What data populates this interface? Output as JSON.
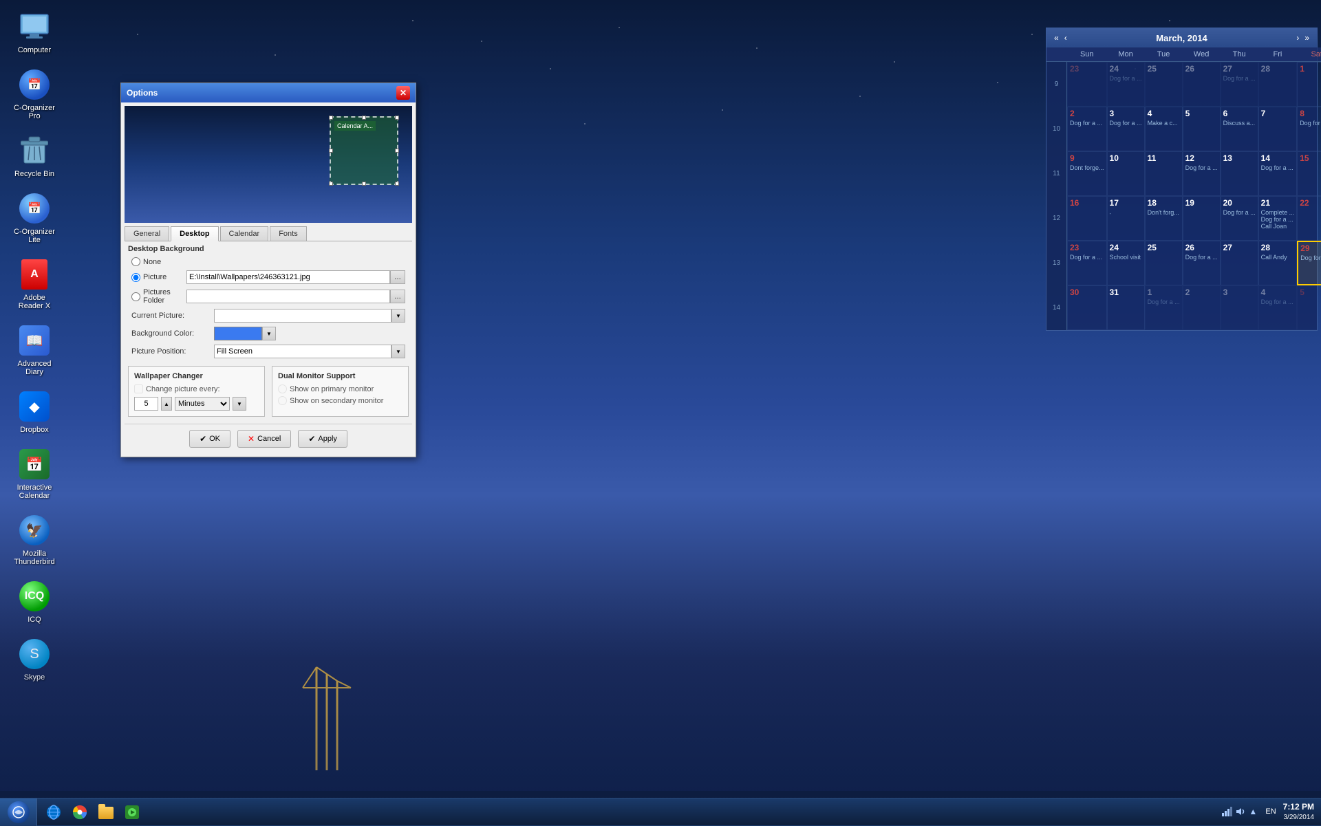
{
  "desktop": {
    "background": "night sky with clouds",
    "icons": [
      {
        "id": "computer",
        "label": "Computer",
        "type": "computer"
      },
      {
        "id": "c-organizer-pro",
        "label": "C-Organizer\nPro",
        "type": "organizer"
      },
      {
        "id": "recycle-bin",
        "label": "Recycle Bin",
        "type": "recycle"
      },
      {
        "id": "c-organizer-lite",
        "label": "C-Organizer\nLite",
        "type": "organizer-lite"
      },
      {
        "id": "adobe-reader",
        "label": "Adobe\nReader X",
        "type": "adobe"
      },
      {
        "id": "advanced-diary",
        "label": "Advanced\nDiary",
        "type": "diary"
      },
      {
        "id": "dropbox",
        "label": "Dropbox",
        "type": "dropbox"
      },
      {
        "id": "interactive-calendar",
        "label": "Interactive\nCalendar",
        "type": "calendar"
      },
      {
        "id": "mozilla-thunderbird",
        "label": "Mozilla\nThunderbird",
        "type": "thunderbird"
      },
      {
        "id": "icq",
        "label": "ICQ",
        "type": "icq"
      },
      {
        "id": "skype",
        "label": "Skype",
        "type": "skype"
      }
    ]
  },
  "calendar_widget": {
    "title": "March, 2014",
    "days_header": [
      "Sun",
      "Mon",
      "Tue",
      "Wed",
      "Thu",
      "Fri",
      "Sat"
    ],
    "week_numbers": [
      9,
      10,
      11,
      12,
      13,
      14
    ],
    "rows": [
      [
        {
          "day": 23,
          "other": true,
          "events": []
        },
        {
          "day": 24,
          "other": true,
          "events": [
            "Dog for a ..."
          ]
        },
        {
          "day": 25,
          "other": true,
          "events": []
        },
        {
          "day": 26,
          "other": true,
          "events": []
        },
        {
          "day": 27,
          "other": true,
          "events": [
            "Dog for a ..."
          ]
        },
        {
          "day": 28,
          "other": true,
          "events": []
        },
        {
          "day": 1,
          "other": false,
          "events": [],
          "red": true
        }
      ],
      [
        {
          "day": 2,
          "other": false,
          "events": [
            "Dog for a ..."
          ],
          "red": true
        },
        {
          "day": 3,
          "other": false,
          "events": [
            "Dog for a ..."
          ]
        },
        {
          "day": 4,
          "other": false,
          "events": [
            "Make a c..."
          ]
        },
        {
          "day": 5,
          "other": false,
          "events": []
        },
        {
          "day": 6,
          "other": false,
          "events": [
            "Discuss a..."
          ]
        },
        {
          "day": 7,
          "other": false,
          "events": []
        },
        {
          "day": 8,
          "other": false,
          "events": [
            "Dog for a ..."
          ],
          "red": true
        }
      ],
      [
        {
          "day": 9,
          "other": false,
          "events": [
            "Dont forge..."
          ],
          "red": true
        },
        {
          "day": 10,
          "other": false,
          "events": []
        },
        {
          "day": 11,
          "other": false,
          "events": []
        },
        {
          "day": 12,
          "other": false,
          "events": [
            "Dog for a ..."
          ]
        },
        {
          "day": 13,
          "other": false,
          "events": []
        },
        {
          "day": 14,
          "other": false,
          "events": [
            "Dog for a ..."
          ]
        },
        {
          "day": 15,
          "other": false,
          "events": [],
          "red": true
        }
      ],
      [
        {
          "day": 16,
          "other": false,
          "events": [],
          "red": true
        },
        {
          "day": 17,
          "other": false,
          "events": []
        },
        {
          "day": 18,
          "other": false,
          "events": [
            "Don't forg..."
          ]
        },
        {
          "day": 19,
          "other": false,
          "events": []
        },
        {
          "day": 20,
          "other": false,
          "events": [
            "Dog for a ..."
          ]
        },
        {
          "day": 21,
          "other": false,
          "events": [
            "Complete ...",
            "Dog for a ...",
            "Call Joan"
          ]
        },
        {
          "day": 22,
          "other": false,
          "events": [],
          "red": true
        }
      ],
      [
        {
          "day": 23,
          "other": false,
          "events": [
            "Dog for a ..."
          ],
          "red": true
        },
        {
          "day": 24,
          "other": false,
          "events": [
            "School visit"
          ]
        },
        {
          "day": 25,
          "other": false,
          "events": []
        },
        {
          "day": 26,
          "other": false,
          "events": [
            "Dog for a ..."
          ]
        },
        {
          "day": 27,
          "other": false,
          "events": []
        },
        {
          "day": 28,
          "other": false,
          "events": [
            "Call Andy"
          ]
        },
        {
          "day": 29,
          "other": false,
          "events": [
            "Dog for a ..."
          ],
          "red": true,
          "today": true
        }
      ],
      [
        {
          "day": 30,
          "other": false,
          "events": [],
          "red": true
        },
        {
          "day": 31,
          "other": false,
          "events": []
        },
        {
          "day": 1,
          "other": true,
          "events": [
            "Dog for a ..."
          ]
        },
        {
          "day": 2,
          "other": true,
          "events": []
        },
        {
          "day": 3,
          "other": true,
          "events": []
        },
        {
          "day": 4,
          "other": true,
          "events": [
            "Dog for a ..."
          ]
        },
        {
          "day": 5,
          "other": true,
          "events": [],
          "red": true
        }
      ]
    ]
  },
  "options_dialog": {
    "title": "Options",
    "tabs": [
      "General",
      "Desktop",
      "Calendar",
      "Fonts"
    ],
    "active_tab": "Desktop",
    "preview_calendar_label": "Calendar A...",
    "section_title": "Desktop Background",
    "radio_none": "None",
    "radio_picture": "Picture",
    "radio_pictures_folder": "Pictures Folder",
    "label_current_picture": "Current Picture:",
    "label_bg_color": "Background Color:",
    "label_picture_position": "Picture Position:",
    "picture_value": "E:\\Install\\Wallpapers\\246363121.jpg",
    "picture_position_value": "Fill Screen",
    "wallpaper_changer_title": "Wallpaper Changer",
    "change_picture_every": "Change picture every:",
    "stepper_value": "5",
    "minutes_label": "Minutes",
    "dual_monitor_title": "Dual Monitor Support",
    "show_primary": "Show on primary monitor",
    "show_secondary": "Show on secondary monitor",
    "btn_ok": "OK",
    "btn_cancel": "Cancel",
    "btn_apply": "Apply"
  },
  "taskbar": {
    "clock_time": "7:12 PM",
    "clock_date": "3/29/2014",
    "language": "EN"
  }
}
